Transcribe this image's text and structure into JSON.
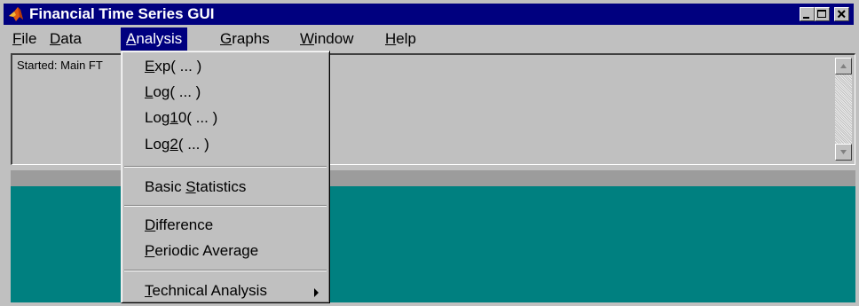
{
  "window": {
    "title": "Financial Time Series GUI",
    "title_bar_color": "#00007f",
    "teal_color": "#008080"
  },
  "menubar": {
    "items": [
      {
        "label": "File"
      },
      {
        "label": "Data"
      },
      {
        "label": "Analysis",
        "active": true
      },
      {
        "label": "Graphs"
      },
      {
        "label": "Window"
      },
      {
        "label": "Help"
      }
    ]
  },
  "log": {
    "text": "Started: Main FT"
  },
  "analysis_menu": {
    "items": [
      {
        "label": "Exp( ... )"
      },
      {
        "label": "Log( ... )"
      },
      {
        "label": "Log10( ... )"
      },
      {
        "label": "Log2( ... )"
      },
      {
        "label": "Basic Statistics"
      },
      {
        "label": "Difference"
      },
      {
        "label": "Periodic Average"
      },
      {
        "label": "Technical Analysis",
        "has_submenu": true
      }
    ]
  },
  "icons": {
    "app": "matlab-icon",
    "minimize": "minimize-icon",
    "maximize": "maximize-icon",
    "close": "close-icon",
    "scroll_up": "arrow-up-icon",
    "scroll_down": "arrow-down-icon",
    "submenu": "chevron-right-icon"
  }
}
